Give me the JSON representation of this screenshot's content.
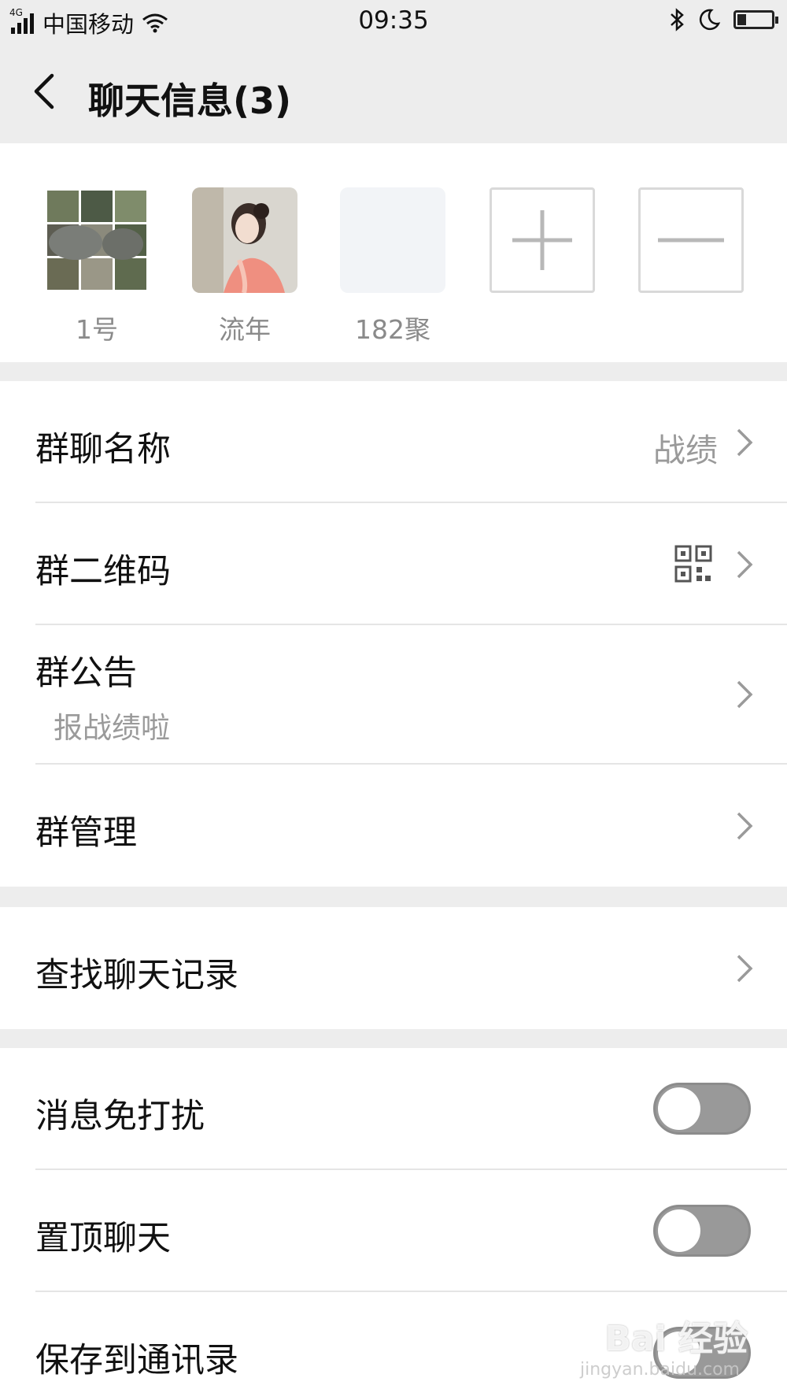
{
  "status_bar": {
    "network_type": "4G",
    "carrier": "中国移动",
    "time": "09:35",
    "battery_level": 0.25
  },
  "nav": {
    "title": "聊天信息(3)"
  },
  "members": [
    {
      "name": "1号"
    },
    {
      "name": "流年"
    },
    {
      "name": "182聚"
    }
  ],
  "settings": {
    "group_name_label": "群聊名称",
    "group_name_value": "战绩",
    "qr_label": "群二维码",
    "notice_label": "群公告",
    "notice_value": "报战绩啦",
    "manage_label": "群管理",
    "search_label": "查找聊天记录",
    "mute_label": "消息免打扰",
    "mute_on": false,
    "pin_label": "置顶聊天",
    "pin_on": false,
    "save_label": "保存到通讯录",
    "save_on": false
  },
  "watermark": {
    "brand": "Bai 经验",
    "url": "jingyan.baidu.com"
  },
  "colors": {
    "background": "#ededed",
    "toggle_off": "#999999",
    "secondary_text": "#9a9a9a"
  }
}
